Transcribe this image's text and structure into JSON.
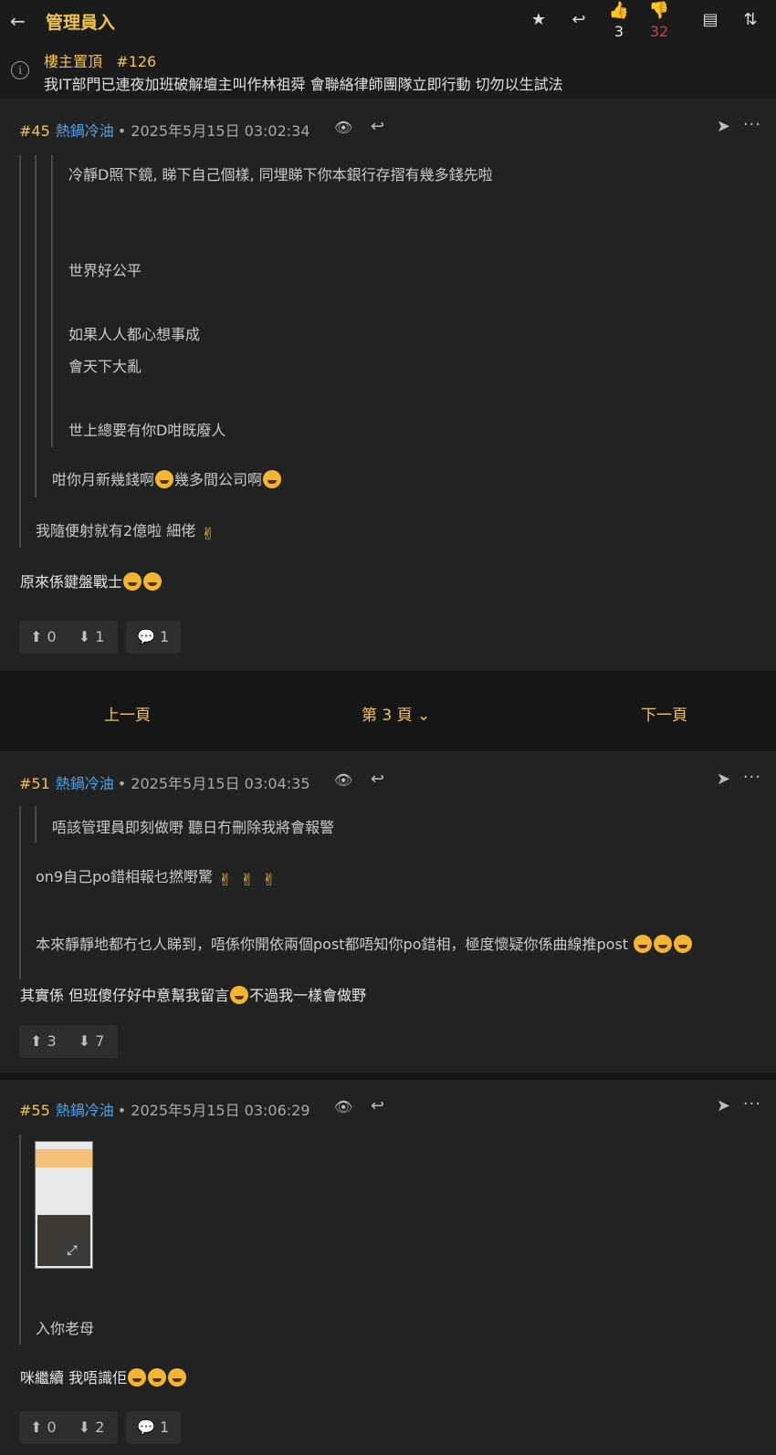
{
  "topbar": {
    "title": "管理員入",
    "like_count": "3",
    "dislike_count": "32"
  },
  "pinned": {
    "label": "樓主置頂",
    "num": "#126",
    "text": "我IT部門已連夜加班破解壇主叫作林祖舜 會聯絡律師團隊立即行動 切勿以生試法"
  },
  "posts": [
    {
      "num": "#45",
      "name": "熱鍋冷油",
      "date": "• 2025年5月15日 03:02:34",
      "quote2": [
        "冷靜D照下鏡, 睇下自己個樣, 同埋睇下你本銀行存摺有幾多錢先啦",
        "世界好公平",
        "如果人人都心想事成",
        "會天下大亂",
        "世上總要有你D咁既廢人"
      ],
      "quote1": "咁你月新幾錢啊",
      "quote1b": "幾多間公司啊",
      "quote0": "我隨便射就有2億啦 細佬",
      "body": "原來係鍵盤戰士",
      "up": "0",
      "down": "1",
      "comments": "1"
    },
    {
      "num": "#51",
      "name": "熱鍋冷油",
      "date": "• 2025年5月15日 03:04:35",
      "quote1": "唔該管理員即刻做嘢 聽日冇刪除我將會報警",
      "quote0a": "on9自己po錯相報乜撚嘢驚",
      "quote0b": "本來靜靜地都冇乜人睇到，唔係你開依兩個post都唔知你po錯相，極度懷疑你係曲線推post",
      "body": "其實係 但班傻仔好中意幫我留言",
      "body_b": "不過我一樣會做野",
      "up": "3",
      "down": "7"
    },
    {
      "num": "#55",
      "name": "熱鍋冷油",
      "date": "• 2025年5月15日 03:06:29",
      "quote0": "入你老母",
      "body": "咪繼續 我唔識佢",
      "up": "0",
      "down": "2",
      "comments": "1"
    }
  ],
  "pager": {
    "prev": "上一頁",
    "current": "第 3 頁",
    "next": "下一頁"
  }
}
